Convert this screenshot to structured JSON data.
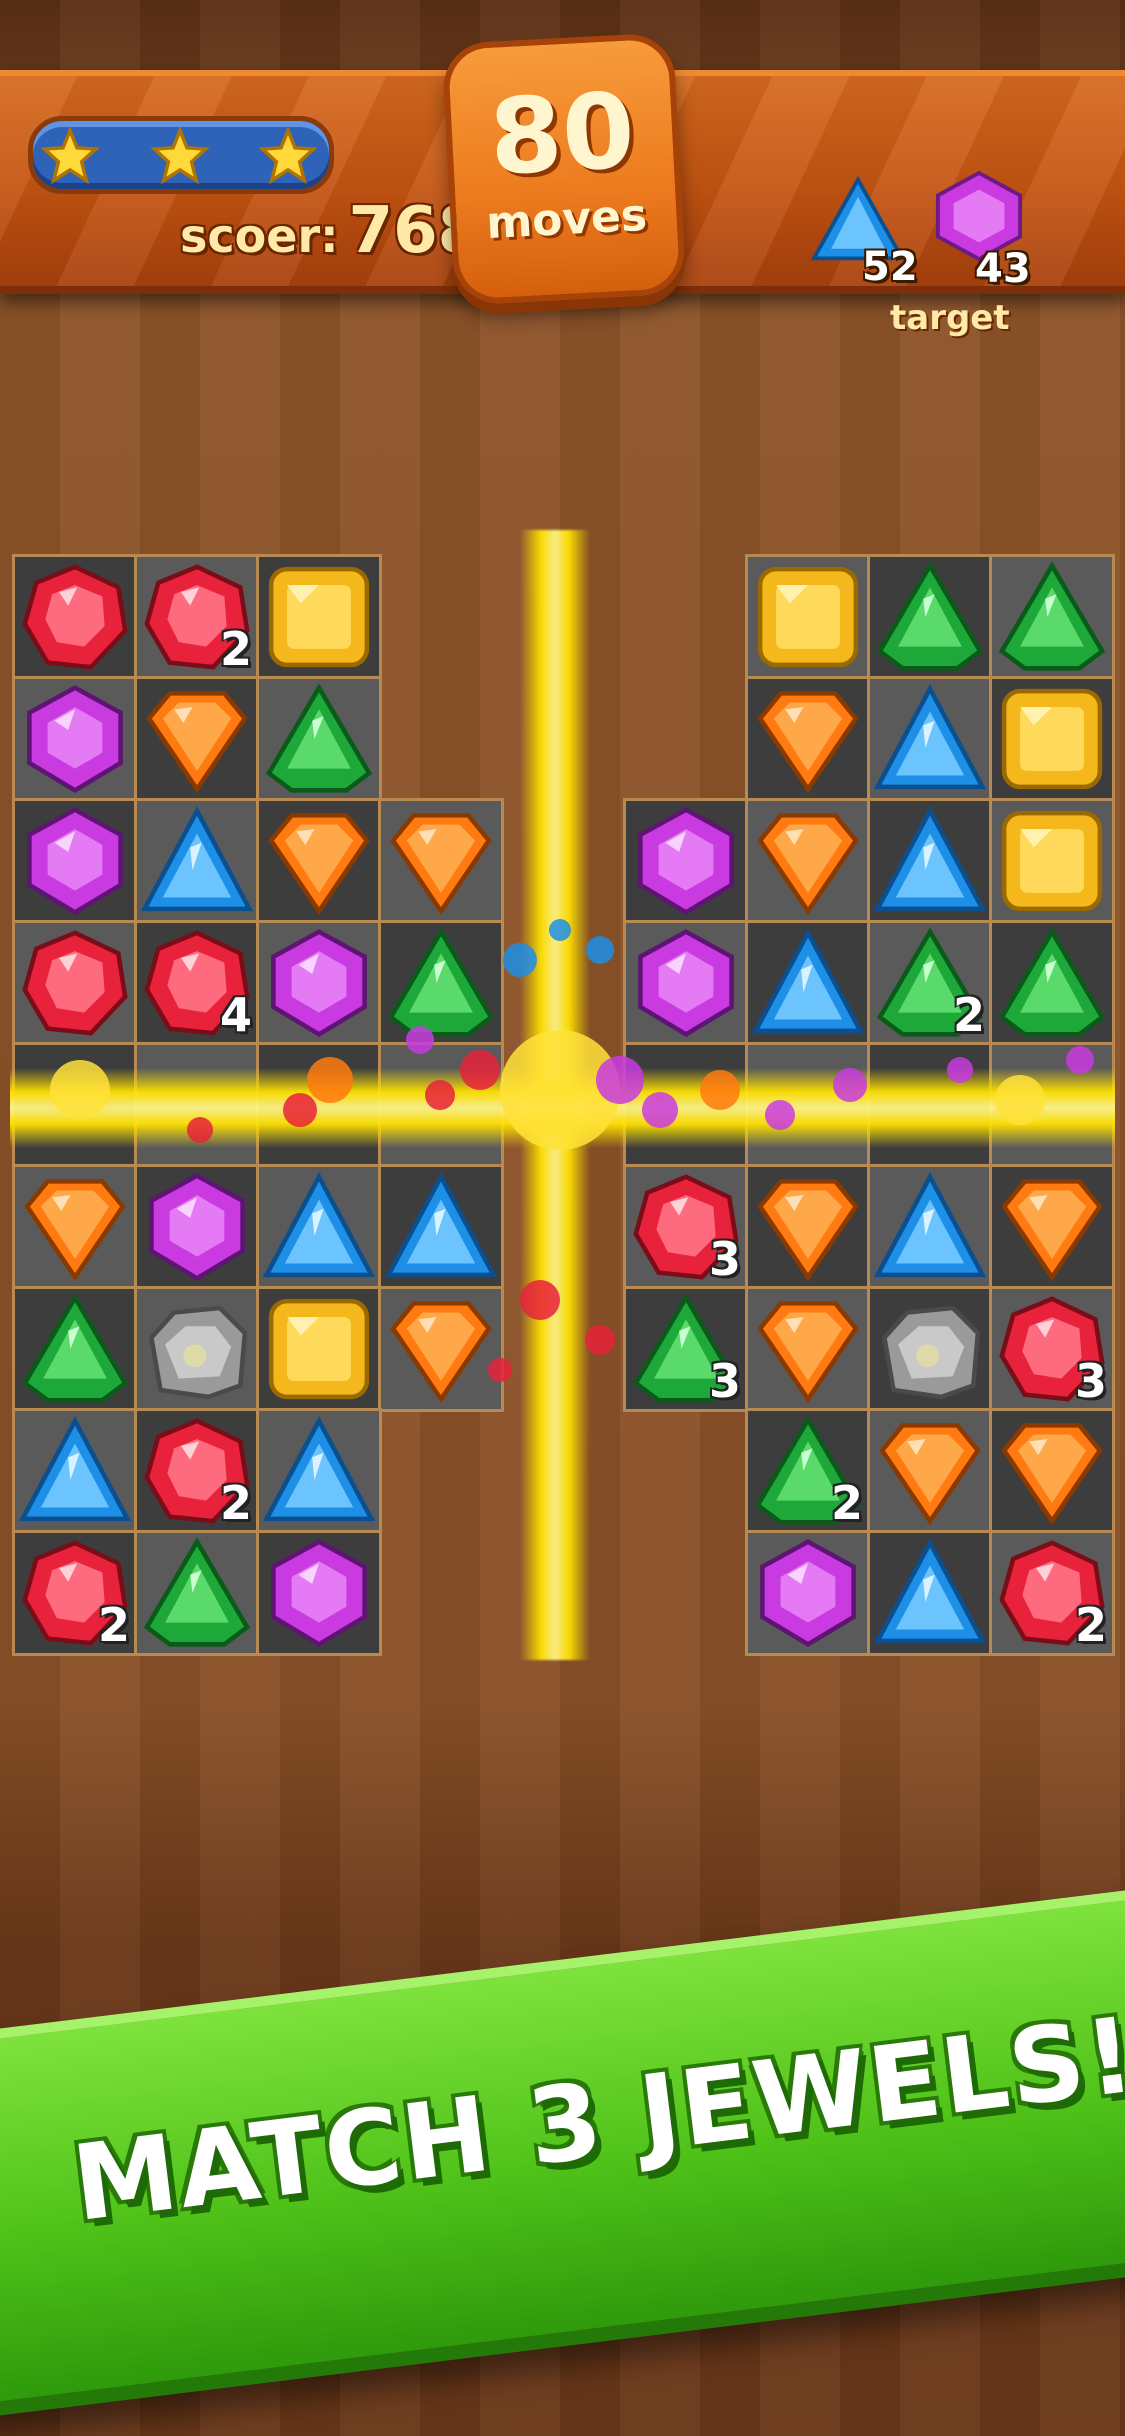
{
  "hud": {
    "stars_earned": 3,
    "score_label": "scoer:",
    "score_value": "768",
    "moves_value": "80",
    "moves_label": "moves",
    "targets": [
      {
        "icon": "blue-triangle-gem-icon",
        "count": "52"
      },
      {
        "icon": "purple-hexagon-gem-icon",
        "count": "43"
      }
    ],
    "target_label": "target"
  },
  "board": {
    "gem_colors": {
      "red": "#e8223a",
      "yellow": "#f5b81c",
      "purple": "#c93be0",
      "orange": "#ff7a10",
      "green": "#1ea83a",
      "blue": "#1d8fe6",
      "stone": "#9a9a9a"
    },
    "left": [
      [
        {
          "g": "red"
        },
        {
          "g": "red",
          "n": "2"
        },
        {
          "g": "yellow"
        },
        null
      ],
      [
        {
          "g": "purple"
        },
        {
          "g": "orange"
        },
        {
          "g": "green"
        },
        null
      ],
      [
        {
          "g": "purple"
        },
        {
          "g": "blue"
        },
        {
          "g": "orange"
        },
        {
          "g": "orange"
        }
      ],
      [
        {
          "g": "red"
        },
        {
          "g": "red",
          "n": "4"
        },
        {
          "g": "purple"
        },
        {
          "g": "green"
        }
      ],
      [
        {
          "g": "empty"
        },
        {
          "g": "empty"
        },
        {
          "g": "empty"
        },
        {
          "g": "empty"
        }
      ],
      [
        {
          "g": "orange"
        },
        {
          "g": "purple"
        },
        {
          "g": "blue"
        },
        {
          "g": "blue"
        }
      ],
      [
        {
          "g": "green"
        },
        {
          "g": "stone"
        },
        {
          "g": "yellow"
        },
        {
          "g": "orange"
        }
      ],
      [
        {
          "g": "blue"
        },
        {
          "g": "red",
          "n": "2"
        },
        {
          "g": "blue"
        },
        null
      ],
      [
        {
          "g": "red",
          "n": "2"
        },
        {
          "g": "green"
        },
        {
          "g": "purple"
        },
        null
      ]
    ],
    "right": [
      [
        null,
        {
          "g": "yellow"
        },
        {
          "g": "green"
        },
        {
          "g": "green"
        }
      ],
      [
        null,
        {
          "g": "orange"
        },
        {
          "g": "blue"
        },
        {
          "g": "yellow"
        }
      ],
      [
        {
          "g": "purple"
        },
        {
          "g": "orange"
        },
        {
          "g": "blue"
        },
        {
          "g": "yellow"
        }
      ],
      [
        {
          "g": "purple"
        },
        {
          "g": "blue"
        },
        {
          "g": "green",
          "n": "2"
        },
        {
          "g": "green"
        }
      ],
      [
        {
          "g": "empty"
        },
        {
          "g": "empty"
        },
        {
          "g": "empty"
        },
        {
          "g": "empty"
        }
      ],
      [
        {
          "g": "red",
          "n": "3"
        },
        {
          "g": "orange"
        },
        {
          "g": "blue"
        },
        {
          "g": "orange"
        }
      ],
      [
        {
          "g": "green",
          "n": "3"
        },
        {
          "g": "orange"
        },
        {
          "g": "stone"
        },
        {
          "g": "red",
          "n": "3"
        }
      ],
      [
        null,
        {
          "g": "green",
          "n": "2"
        },
        {
          "g": "orange"
        },
        {
          "g": "orange"
        }
      ],
      [
        null,
        {
          "g": "purple"
        },
        {
          "g": "blue"
        },
        {
          "g": "red",
          "n": "2"
        }
      ]
    ]
  },
  "banner": {
    "text": "MATCH 3 JEWELS!"
  }
}
